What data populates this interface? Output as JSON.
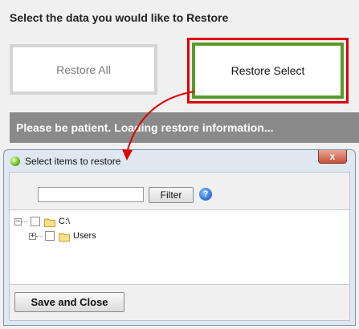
{
  "page": {
    "heading": "Select the data you would like to Restore",
    "restore_all_label": "Restore All",
    "restore_select_label": "Restore Select",
    "status_text": "Please be patient. Loading restore information..."
  },
  "dialog": {
    "title": "Select items to restore",
    "close_label": "x",
    "filter": {
      "value": "",
      "button_label": "Filter"
    },
    "help_label": "?",
    "tree": [
      {
        "label": "C:\\",
        "expander": "−"
      },
      {
        "label": "Users",
        "expander": "+"
      }
    ],
    "save_close_label": "Save and Close"
  },
  "colors": {
    "highlight": "#e00000",
    "selected_border": "#5a9a2a",
    "status_bg": "#8a8a8a"
  }
}
